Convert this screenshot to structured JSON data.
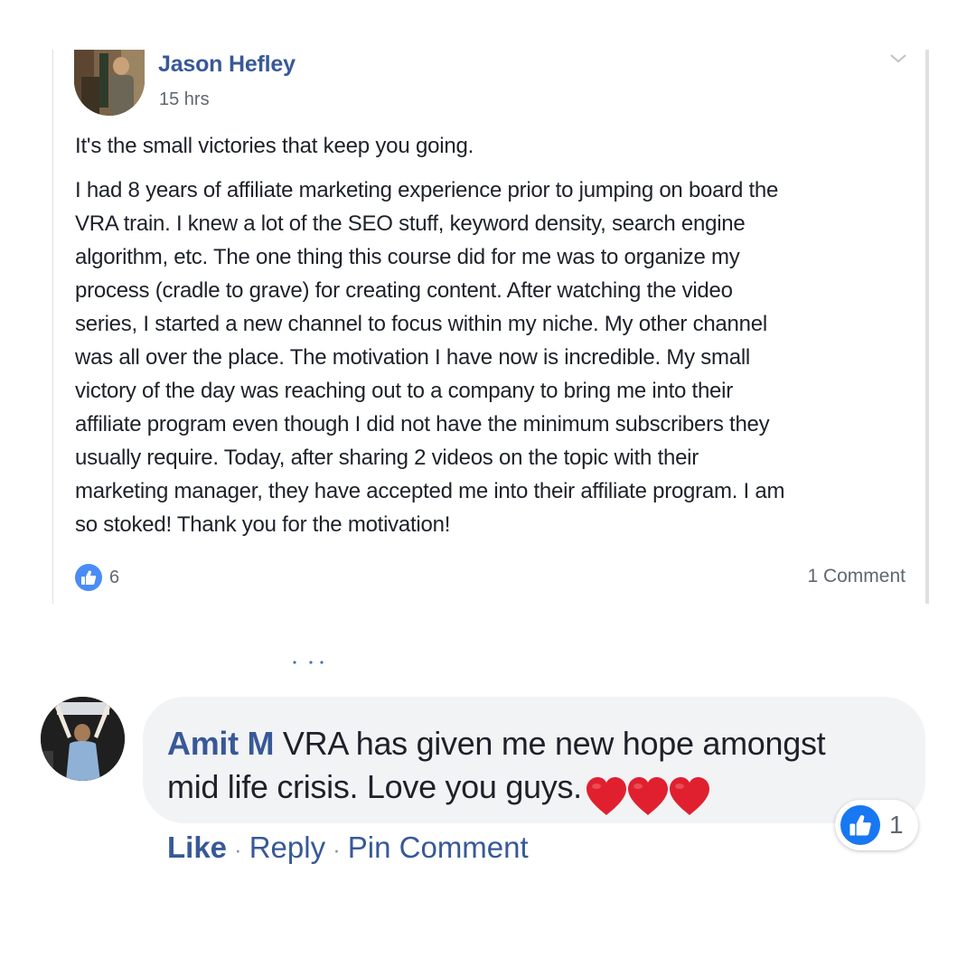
{
  "post": {
    "author": "Jason Hefley",
    "time": "15 hrs",
    "headline": "It's the small victories that keep you going.",
    "body_lines": [
      "I had 8 years of affiliate marketing experience prior to jumping on board the",
      "VRA train. I knew a lot of the SEO stuff, keyword density, search engine",
      "algorithm, etc. The one thing this course did for me was to organize my",
      "process (cradle to grave) for creating content. After watching the video",
      "series, I started a new channel to focus within my niche. My other channel",
      "was all over the place. The motivation I have now is incredible. My small",
      "victory of the day was reaching out to a company to bring me into their",
      "affiliate program even though I did not have the minimum subscribers they",
      "usually require. Today, after sharing 2 videos on the topic with their",
      "marketing manager, they have accepted me into their affiliate program. I am",
      "so stoked! Thank you for the motivation!"
    ],
    "like_count": "6",
    "comment_count": "1 Comment",
    "menu_icon": "chevron-down-icon",
    "like_icon": "thumbs-up-icon"
  },
  "comment": {
    "author": "Amit M",
    "text_line1": "VRA has given me new hope amongst",
    "text_line2": "mid life crisis. Love you guys.",
    "heart_icon": "red-heart-icon",
    "heart_count": 3,
    "like_count": "1",
    "actions": {
      "like": "Like",
      "reply": "Reply",
      "pin": "Pin Comment",
      "separator": "·"
    }
  },
  "colors": {
    "author_blue": "#385898",
    "text": "#1d2129",
    "meta_gray": "#606770",
    "bubble_bg": "#f2f3f5",
    "like_blue": "#1877f2",
    "heart_red": "#e0202f"
  }
}
